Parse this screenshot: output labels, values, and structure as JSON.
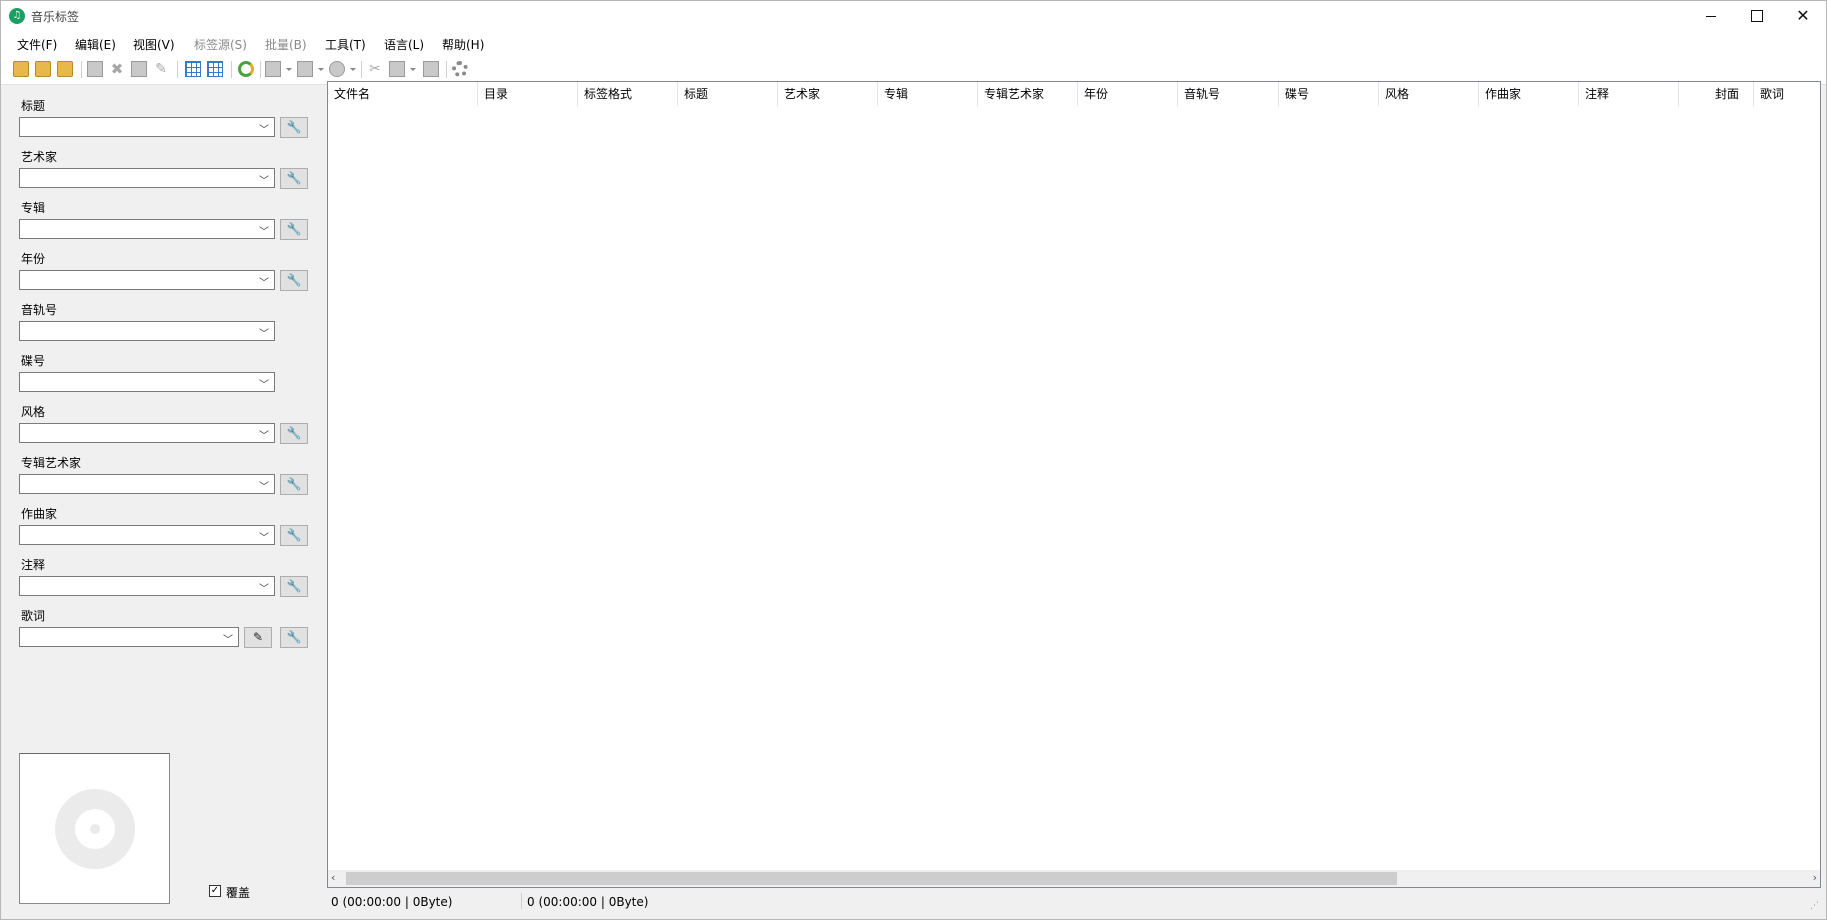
{
  "window": {
    "title": "音乐标签"
  },
  "menu": [
    {
      "label": "文件(F)",
      "disabled": false
    },
    {
      "label": "编辑(E)",
      "disabled": false
    },
    {
      "label": "视图(V)",
      "disabled": false
    },
    {
      "label": "标签源(S)",
      "disabled": true
    },
    {
      "label": "批量(B)",
      "disabled": true
    },
    {
      "label": "工具(T)",
      "disabled": false
    },
    {
      "label": "语言(L)",
      "disabled": false
    },
    {
      "label": "帮助(H)",
      "disabled": false
    }
  ],
  "fields": [
    {
      "label": "标题",
      "value": ""
    },
    {
      "label": "艺术家",
      "value": ""
    },
    {
      "label": "专辑",
      "value": ""
    },
    {
      "label": "年份",
      "value": ""
    },
    {
      "label": "音轨号",
      "value": ""
    },
    {
      "label": "碟号",
      "value": ""
    },
    {
      "label": "风格",
      "value": ""
    },
    {
      "label": "专辑艺术家",
      "value": ""
    },
    {
      "label": "作曲家",
      "value": ""
    },
    {
      "label": "注释",
      "value": ""
    },
    {
      "label": "歌词",
      "value": ""
    }
  ],
  "cover": {
    "overwrite_label": "覆盖",
    "overwrite_checked": true
  },
  "columns": [
    "文件名",
    "目录",
    "标签格式",
    "标题",
    "艺术家",
    "专辑",
    "专辑艺术家",
    "年份",
    "音轨号",
    "碟号",
    "风格",
    "作曲家",
    "注释",
    "封面",
    "歌词"
  ],
  "status": {
    "left": "0 (00:00:00 | 0Byte)",
    "right": "0 (00:00:00 | 0Byte)"
  },
  "icons": {
    "app": "music-note-icon",
    "field_tool": "wrench-icon",
    "lyrics_edit": "edit-icon",
    "cover_placeholder": "disc-icon",
    "accent_color": "#1aa062"
  }
}
